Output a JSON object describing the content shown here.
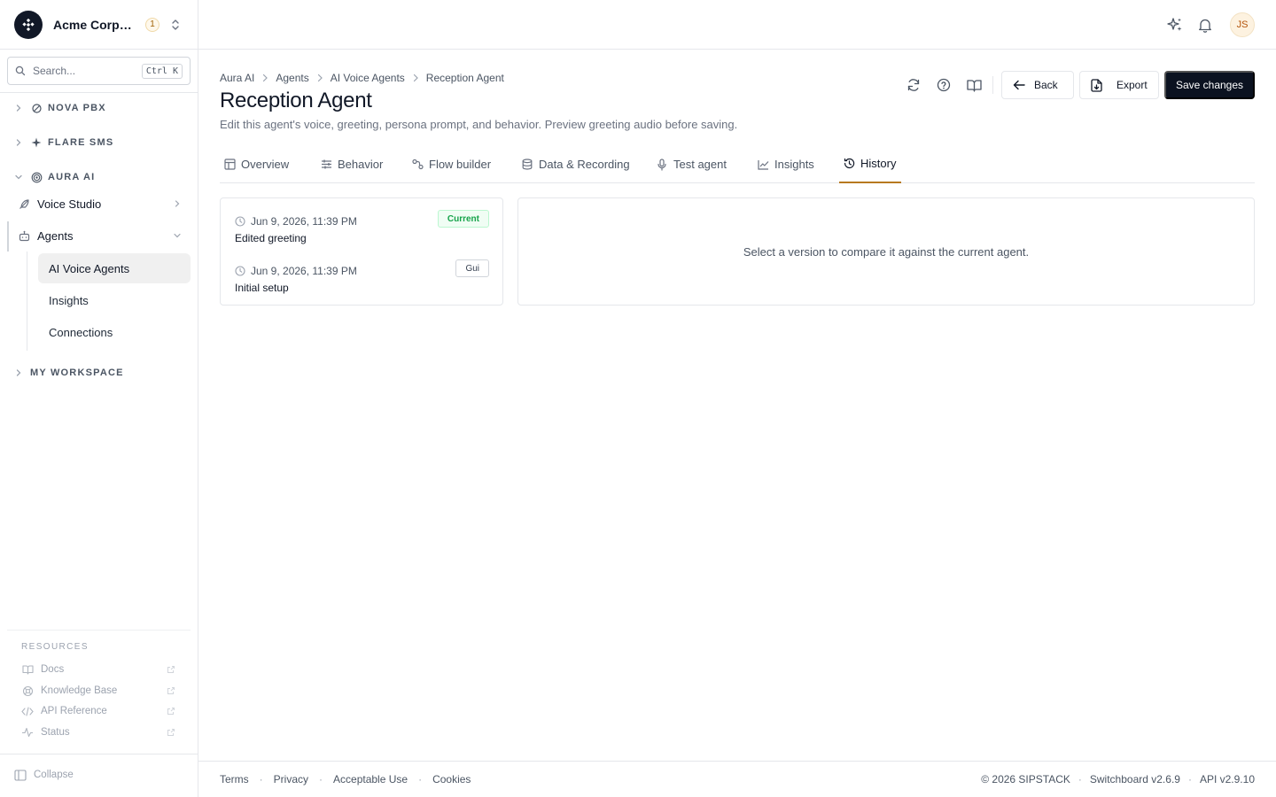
{
  "org": {
    "name": "Acme Corporation",
    "notification_count": "1"
  },
  "search": {
    "placeholder": "Search...",
    "shortcut": "Ctrl K"
  },
  "sidebar": {
    "groups": [
      {
        "label": "NOVA PBX",
        "icon": "nova-pbx-icon"
      },
      {
        "label": "FLARE SMS",
        "icon": "sparkle-icon"
      },
      {
        "label": "AURA AI",
        "icon": "aura-ai-icon"
      },
      {
        "label": "MY WORKSPACE"
      }
    ],
    "items": [
      {
        "label": "Voice Studio",
        "icon": "feather-icon"
      },
      {
        "label": "Agents",
        "icon": "bot-icon"
      }
    ],
    "sub_items": [
      {
        "label": "AI Voice Agents",
        "active": true
      },
      {
        "label": "Insights"
      },
      {
        "label": "Connections"
      }
    ],
    "resources_title": "RESOURCES",
    "resources": [
      {
        "label": "Docs",
        "icon": "book-icon"
      },
      {
        "label": "Knowledge Base",
        "icon": "lifebuoy-icon"
      },
      {
        "label": "API Reference",
        "icon": "code-icon"
      },
      {
        "label": "Status",
        "icon": "activity-icon"
      }
    ],
    "collapse_label": "Collapse"
  },
  "topbar": {
    "avatar_initials": "JS"
  },
  "breadcrumb": [
    "Aura AI",
    "Agents",
    "AI Voice Agents",
    "Reception Agent"
  ],
  "page": {
    "title": "Reception Agent",
    "subtitle": "Edit this agent's voice, greeting, persona prompt, and behavior. Preview greeting audio before saving."
  },
  "actions": {
    "back": "Back",
    "export": "Export",
    "save": "Save changes"
  },
  "tabs": [
    {
      "label": "Overview",
      "icon": "layout-icon"
    },
    {
      "label": "Behavior",
      "icon": "sliders-icon"
    },
    {
      "label": "Flow builder",
      "icon": "flow-icon"
    },
    {
      "label": "Data & Recording",
      "icon": "database-icon"
    },
    {
      "label": "Test agent",
      "icon": "mic-icon"
    },
    {
      "label": "Insights",
      "icon": "chart-icon"
    },
    {
      "label": "History",
      "icon": "history-icon",
      "active": true
    }
  ],
  "versions": [
    {
      "timestamp": "Jun 9, 2026, 11:39 PM",
      "description": "Edited greeting",
      "badge": "Current"
    },
    {
      "timestamp": "Jun 9, 2026, 11:39 PM",
      "description": "Initial setup",
      "badge": "Gui"
    }
  ],
  "compare": {
    "empty_text": "Select a version to compare it against the current agent."
  },
  "footer": {
    "links": [
      "Terms",
      "Privacy",
      "Acceptable Use",
      "Cookies"
    ],
    "copyright": "© 2026 SIPSTACK",
    "version": "Switchboard v2.6.9",
    "api": "API v2.9.10"
  },
  "colors": {
    "accent": "#b7791f",
    "primary_button": "#0b1220",
    "current_badge": "#16a34a"
  }
}
